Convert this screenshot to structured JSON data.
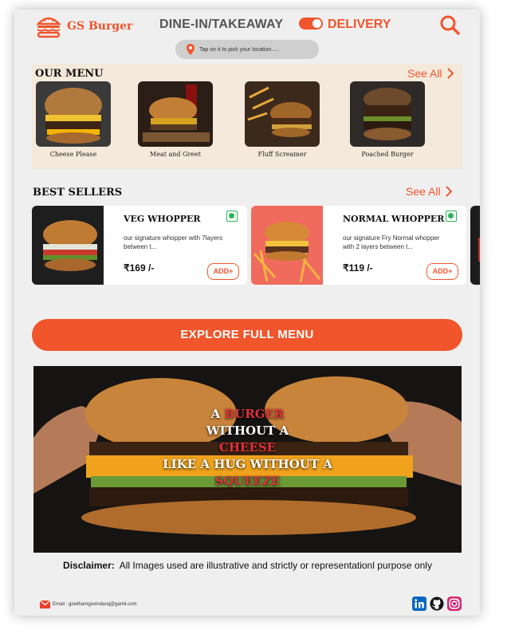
{
  "header": {
    "brand": "GS Burger",
    "mode_label": "DINE-IN/TAKEAWAY",
    "delivery_label": "DELIVERY",
    "location_hint": "Tap on it to pick your location....."
  },
  "our_menu": {
    "title": "OUR MENU",
    "see_all": "See All",
    "items": [
      {
        "name": "Cheese Please"
      },
      {
        "name": "Meat and Greet"
      },
      {
        "name": "Fluff Screamer"
      },
      {
        "name": "Poached Burger"
      }
    ]
  },
  "best_sellers": {
    "title": "BEST SELLERS",
    "see_all": "See All",
    "cards": [
      {
        "title": "VEG WHOPPER",
        "desc": "our signature whopper with 7layers between t...",
        "price": "₹169 /-",
        "add": "ADD+"
      },
      {
        "title": "NORMAL WHOPPER",
        "desc": "our signature Fry Normal whopper with  2 layers between t...",
        "price": "₹119 /-",
        "add": "ADD+"
      }
    ]
  },
  "cta": {
    "explore": "EXPLORE FULL MENU"
  },
  "banner": {
    "w1": "A",
    "w2": "BURGER",
    "l2": "WITHOUT A",
    "l3": "CHEESE",
    "l4": "LIKE A HUG WITHOUT A",
    "l5": "SQUEEZE"
  },
  "disclaimer": {
    "label": "Disclaimer:",
    "text": "All Images used are illustrative and strictly or representationl purpose only"
  },
  "footer": {
    "email": "Email : gowthamgovindaraj@gamil.com"
  },
  "colors": {
    "accent": "#f0552b",
    "veg": "#2db35a",
    "panel": "#f5e9dc"
  }
}
